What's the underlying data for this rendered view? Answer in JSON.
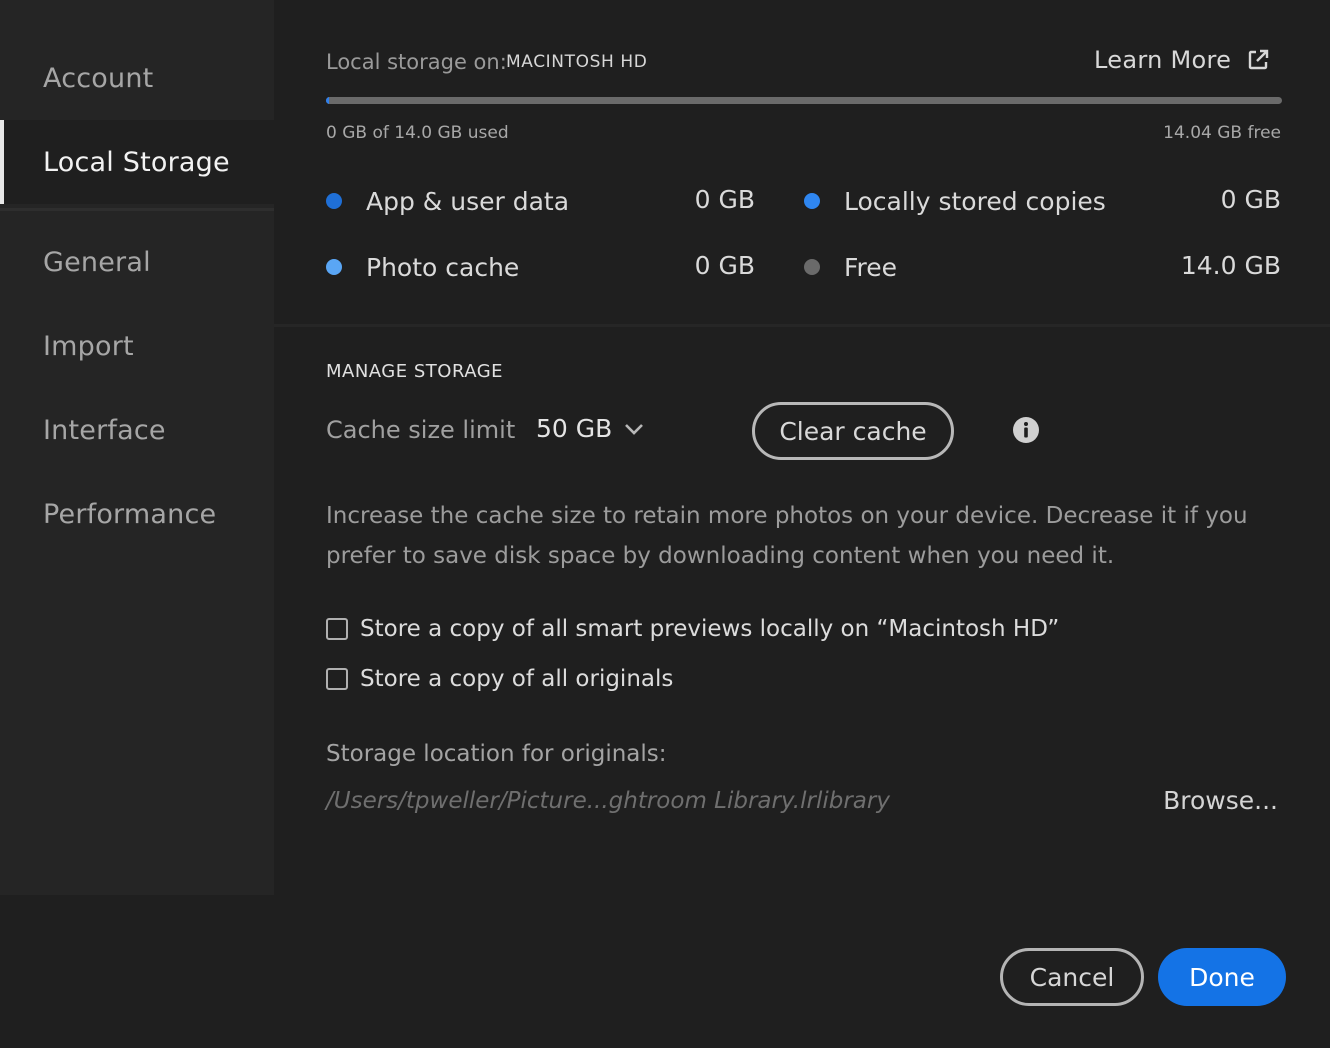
{
  "sidebar": {
    "items": [
      {
        "label": "Account"
      },
      {
        "label": "Local Storage"
      },
      {
        "label": "General"
      },
      {
        "label": "Import"
      },
      {
        "label": "Interface"
      },
      {
        "label": "Performance"
      }
    ],
    "active": "Local Storage"
  },
  "storage": {
    "label": "Local storage on:",
    "volume": "MACINTOSH HD",
    "learn_more": "Learn More",
    "learn_more_icon": "external-link-icon",
    "used_text": "0 GB of 14.0 GB used",
    "free_text": "14.04 GB free",
    "used_fraction": 0.003,
    "legend": [
      {
        "label": "App & user data",
        "value": "0 GB",
        "color": "#1f6fd6"
      },
      {
        "label": "Locally stored copies",
        "value": "0 GB",
        "color": "#2f86f0"
      },
      {
        "label": "Photo cache",
        "value": "0 GB",
        "color": "#5aa6f5"
      },
      {
        "label": "Free",
        "value": "14.0 GB",
        "color": "#6a6a6a"
      }
    ]
  },
  "manage": {
    "title": "MANAGE STORAGE",
    "cache_label": "Cache size limit",
    "cache_value": "50 GB",
    "clear_cache": "Clear cache",
    "info_icon": "info-icon",
    "description": "Increase the cache size to retain more photos on your device. Decrease it if you prefer to save disk space by downloading content when you need it.",
    "checkbox_previews": "Store a copy of all smart previews locally on “Macintosh HD”",
    "checkbox_originals": "Store a copy of all originals",
    "location_label": "Storage location for originals:",
    "location_path": "/Users/tpweller/Picture...ghtroom Library.lrlibrary",
    "browse": "Browse..."
  },
  "footer": {
    "cancel": "Cancel",
    "done": "Done"
  },
  "colors": {
    "accent": "#1473e6",
    "background": "#1f1f1f",
    "sidebar": "#252525"
  }
}
